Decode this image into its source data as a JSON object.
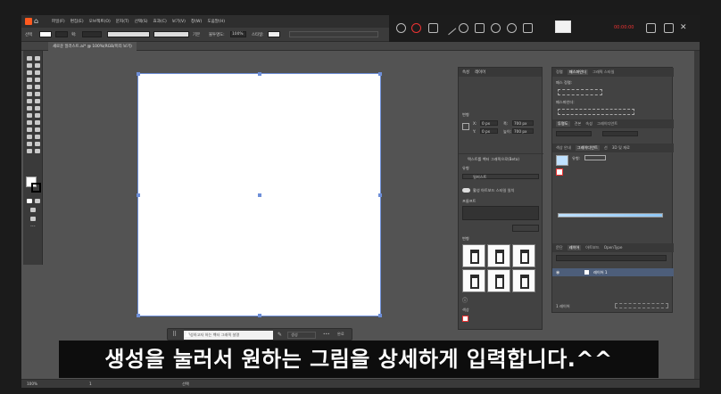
{
  "app": {
    "menu": [
      "파일(F)",
      "편집(E)",
      "오브젝트(O)",
      "문자(T)",
      "선택(S)",
      "효과(C)",
      "보기(V)",
      "창(W)",
      "도움말(H)"
    ]
  },
  "control_bar": {
    "mode_label": "선택",
    "stroke_label": "획:",
    "stroke_value": "기본",
    "opacity_label": "불투명도:",
    "opacity_value": "100%",
    "style_label": "스타일:"
  },
  "document_tab": "새로운 일러스트.ai* @ 100%(RGB/미리 보기)",
  "properties_panel": {
    "tabs": [
      "속성",
      "레이어"
    ],
    "section_transform": "변형",
    "x_label": "X:",
    "x_value": "0 px",
    "y_label": "Y:",
    "y_value": "0 px",
    "w_label": "폭:",
    "w_value": "700 px",
    "h_label": "높이:",
    "h_value": "700 px",
    "section_generate": "텍스트를 벡터 그래픽으로(Beta)",
    "type_label": "유형",
    "type_value": "일러스트",
    "toggle_label": "활성 아트보드 스타일 일치",
    "prompt_label": "프롬프트",
    "variations_label": "변형",
    "section_color": "색상"
  },
  "right_panel": {
    "tabs_top": [
      "정렬",
      "패스파인더",
      "그래픽 스타일"
    ],
    "align_label": "패스 정렬:",
    "pathfinder_label": "패스파인더:",
    "tabs_color": [
      "투명도",
      "견본",
      "속성",
      "그레이디언트"
    ],
    "tabs_mid": [
      "색상 안내",
      "그레이디언트",
      "선",
      "3D 및 재료"
    ],
    "type_label": "유형:",
    "tabs_layers": [
      "문단",
      "레이어",
      "아트보드",
      "OpenType"
    ],
    "layer_name": "레이어 1",
    "layer_count": "1 레이어"
  },
  "context_bar": {
    "prompt_placeholder": "생성하고자 하는 벡터 그래픽 설명",
    "generate_label": "생성",
    "more_label": "•••",
    "close_label": "완료"
  },
  "status_bar": {
    "zoom": "100%",
    "page": "1",
    "tool": "선택"
  },
  "subtitle": "생성을 눌러서 원하는 그림을 상세하게 입력합니다.^^",
  "recorder": {
    "timer": "00:00:00"
  }
}
